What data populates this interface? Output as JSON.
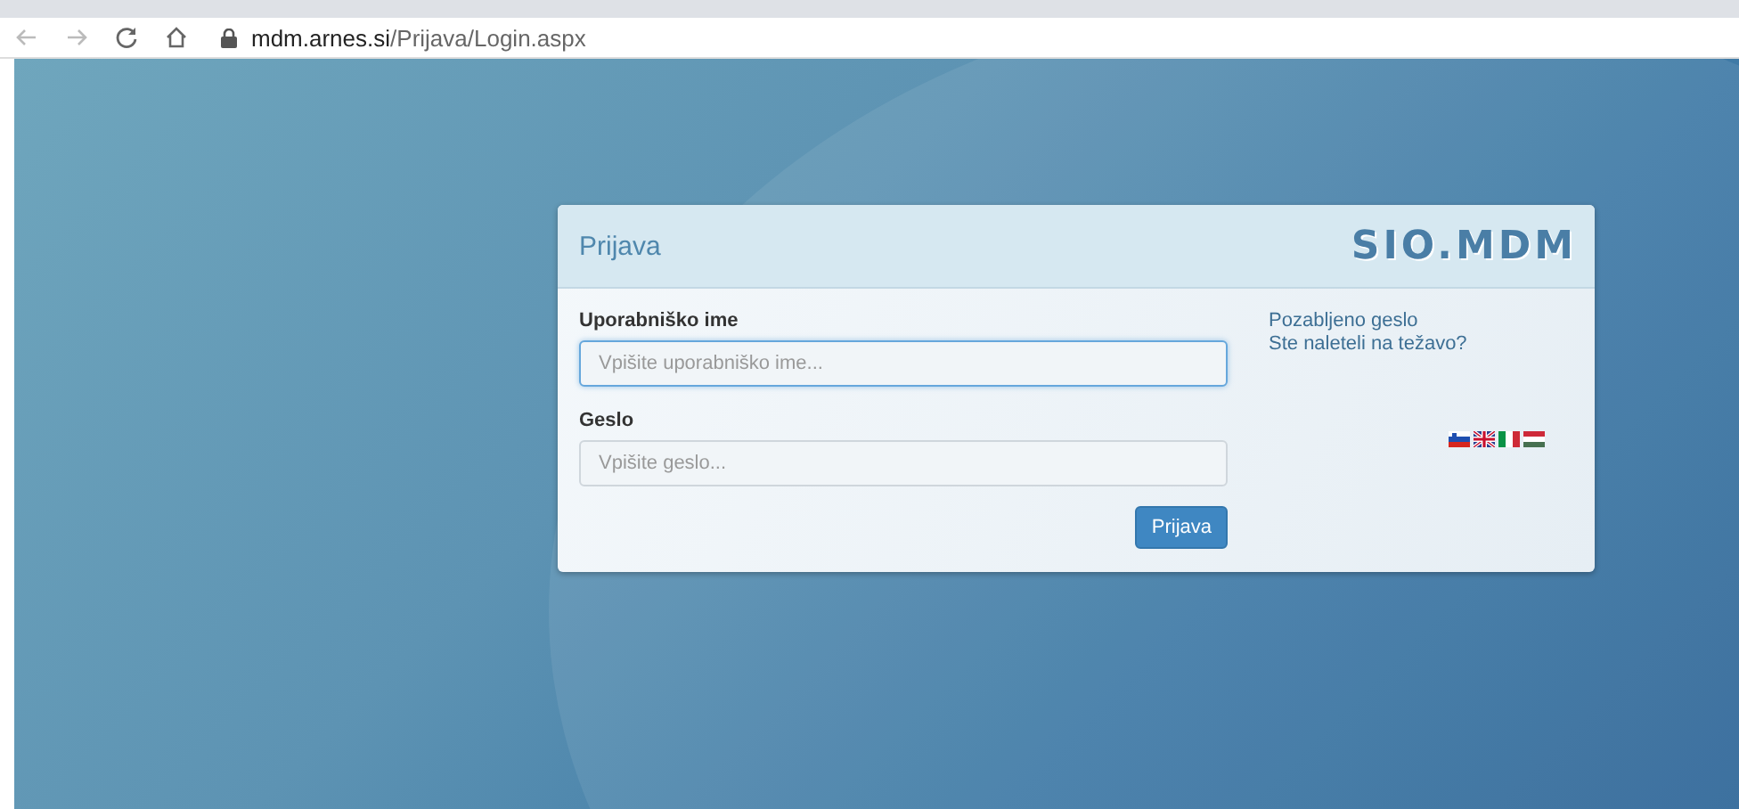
{
  "browser": {
    "url_host": "mdm.arnes.si",
    "url_path": "/Prijava/Login.aspx"
  },
  "login": {
    "title": "Prijava",
    "logo": "SIO.MDM",
    "fields": [
      {
        "label": "Uporabniško ime",
        "placeholder": "Vpišite uporabniško ime...",
        "focused": true
      },
      {
        "label": "Geslo",
        "placeholder": "Vpišite geslo...",
        "focused": false
      }
    ],
    "submit": "Prijava",
    "links": [
      "Pozabljeno geslo",
      "Ste naleteli na težavo?"
    ],
    "flags": [
      {
        "kind": "si"
      },
      {
        "kind": "gb"
      },
      {
        "kind": "it"
      },
      {
        "kind": "hu"
      }
    ]
  }
}
